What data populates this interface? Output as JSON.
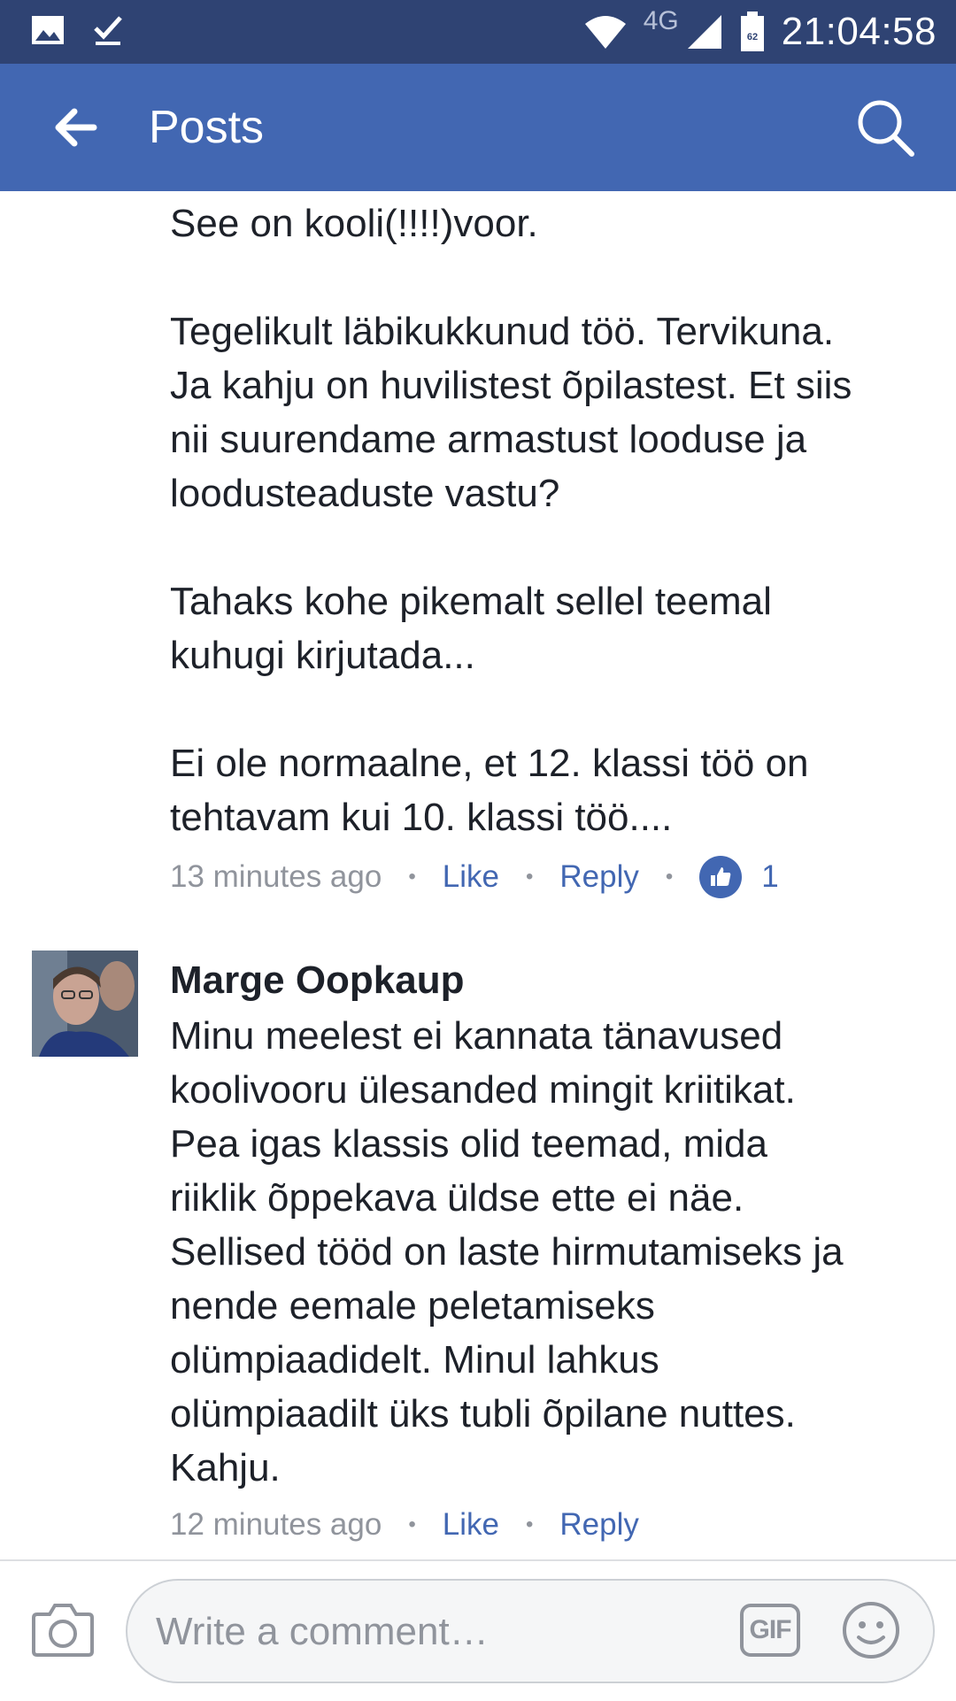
{
  "status_bar": {
    "time": "21:04:58",
    "network": "4G",
    "icons": [
      "image-icon",
      "download-done-icon",
      "wifi-icon",
      "signal-icon",
      "battery-icon"
    ]
  },
  "app_bar": {
    "title": "Posts",
    "icons": [
      "back-arrow-icon",
      "search-icon"
    ],
    "color": "#4267b2"
  },
  "comments": [
    {
      "author": "",
      "paragraphs": [
        "See on kooli(!!!!)voor.",
        "Tegelikult läbikukkunud töö. Tervikuna.\nJa kahju on huvilistest õpilastest. Et siis\nnii suurendame armastust looduse ja\nloodusteaduste vastu?",
        "Tahaks kohe pikemalt sellel teemal\nkuhugi kirjutada...",
        "Ei ole normaalne, et 12. klassi töö on\ntehtavam kui 10. klassi töö...."
      ],
      "time": "13 minutes ago",
      "like_label": "Like",
      "reply_label": "Reply",
      "reaction_count": "1"
    },
    {
      "author": "Marge Oopkaup",
      "paragraphs": [
        "Minu meelest ei kannata tänavused\nkoolivooru ülesanded mingit kriitikat.\n Pea igas klassis olid teemad, mida\nriiklik õppekava üldse ette ei näe.\nSellised tööd on laste hirmutamiseks ja\nnende eemale peletamiseks\nolümpiaadidelt. Minul lahkus\nolümpiaadilt üks tubli õpilane nuttes.\nKahju."
      ],
      "time": "12 minutes ago",
      "like_label": "Like",
      "reply_label": "Reply"
    }
  ],
  "composer": {
    "placeholder": "Write a comment…",
    "gif_label": "GIF",
    "icons": [
      "camera-icon",
      "emoji-icon"
    ]
  }
}
